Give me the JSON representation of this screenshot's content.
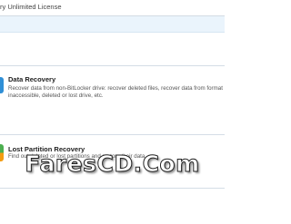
{
  "window": {
    "title": "ry Unlimited License"
  },
  "cards": [
    {
      "title": "Data Recovery",
      "description_line1": "Recover data from non-BitLocker drive: recover deleted files, recover data from formatted,",
      "description_line2": "inaccessible, deleted or lost drive, etc.",
      "icon": "data-recovery-icon"
    },
    {
      "title": "Lost Partition Recovery",
      "description_line1": "Find out deleted or lost partitions and restore their data.",
      "icon": "partition-recovery-icon"
    }
  ],
  "watermark": {
    "text": "FaresCD.Com"
  },
  "colors": {
    "header_band": "#eaf4fc",
    "divider": "#d4dde6",
    "icon_blue": "#2f8fd6",
    "icon_green": "#4caf50",
    "icon_orange": "#f39c12"
  }
}
